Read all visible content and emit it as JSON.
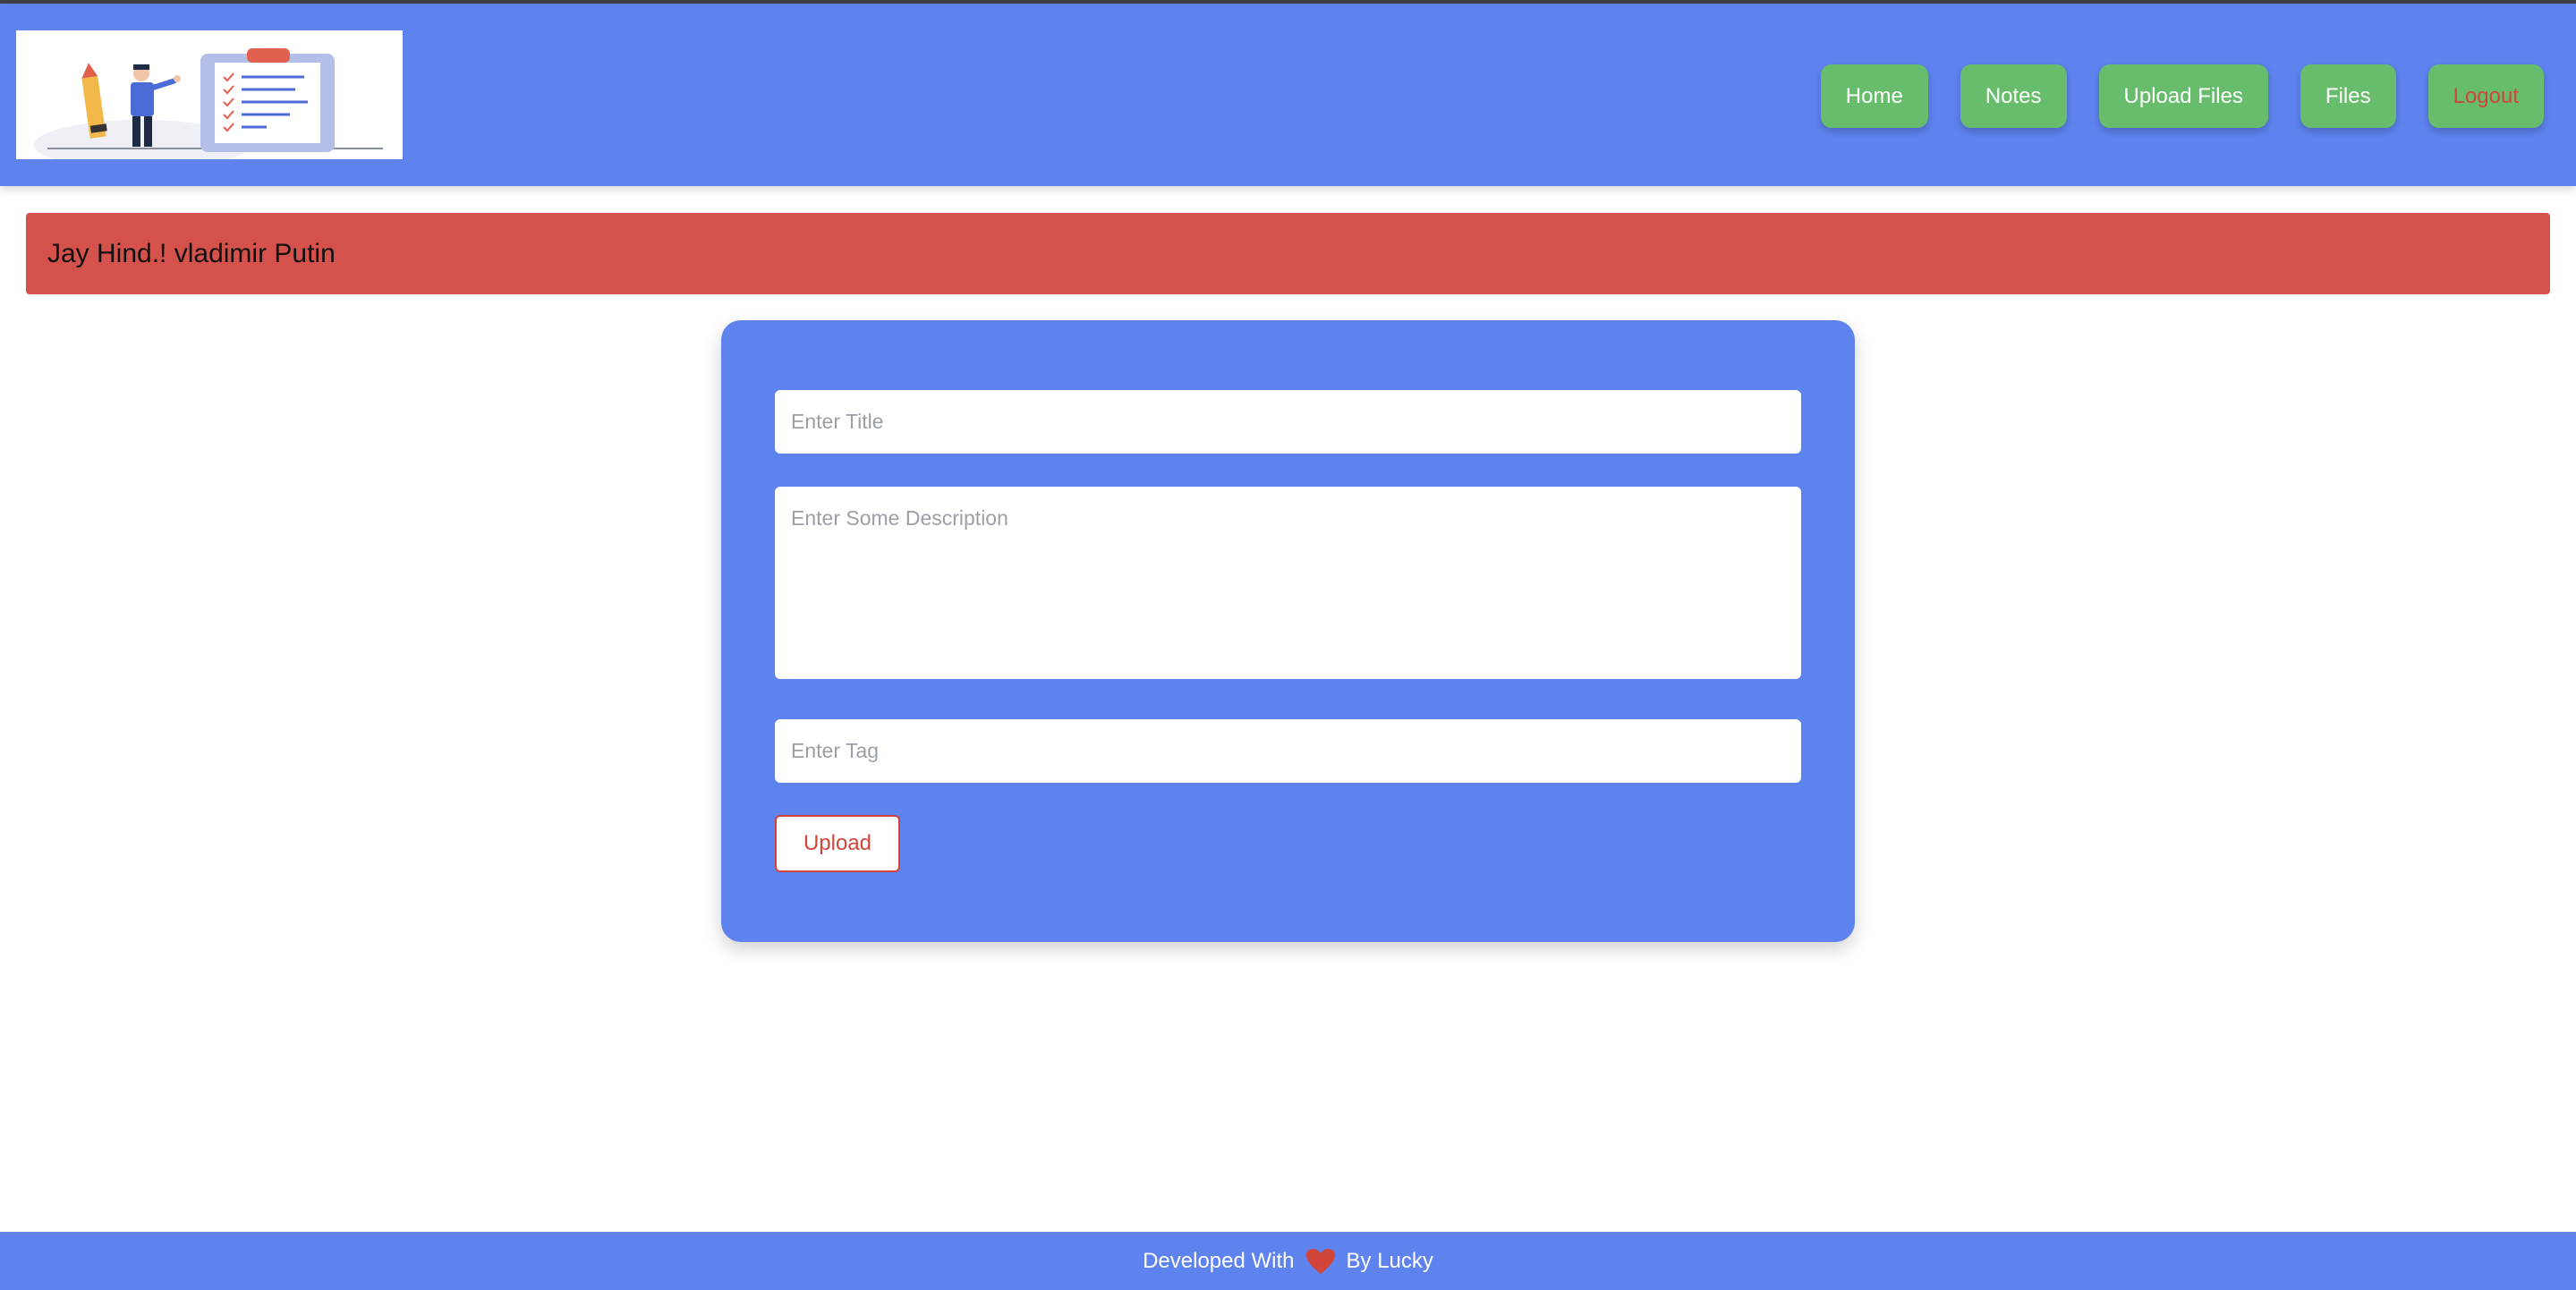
{
  "header": {
    "logo_alt": "Notes app logo illustration",
    "nav": [
      {
        "label": "Home"
      },
      {
        "label": "Notes"
      },
      {
        "label": "Upload Files"
      },
      {
        "label": "Files"
      },
      {
        "label": "Logout"
      }
    ]
  },
  "alert": {
    "text": "Jay Hind.! vladimir Putin"
  },
  "form": {
    "title_placeholder": "Enter Title",
    "description_placeholder": "Enter Some Description",
    "tag_placeholder": "Enter Tag",
    "title_value": "",
    "description_value": "",
    "tag_value": "",
    "upload_label": "Upload"
  },
  "footer": {
    "prefix": "Developed With",
    "icon": "heart-icon",
    "suffix": "By Lucky"
  },
  "colors": {
    "primary": "#5e82ee",
    "nav_button": "#68bd6d",
    "alert": "#d5524c",
    "danger_text": "#d0443a"
  }
}
